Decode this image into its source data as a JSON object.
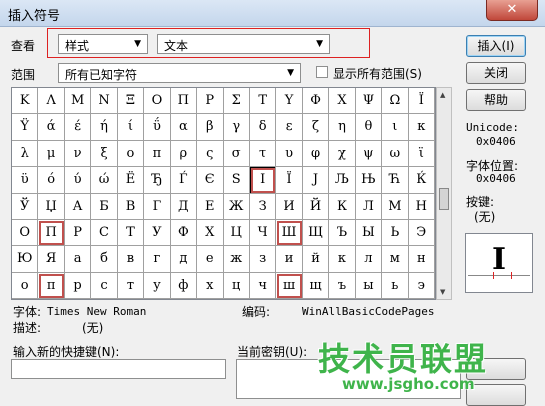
{
  "window": {
    "title": "插入符号",
    "close_glyph": "✕"
  },
  "look_in": {
    "label": "查看",
    "font_value": "样式",
    "type_value": "文本"
  },
  "range": {
    "label": "范围",
    "value": "所有已知字符",
    "show_all_label": "显示所有范围(S)",
    "show_all_checked": false
  },
  "buttons": {
    "insert": "插入(I)",
    "close": "关闭",
    "help": "帮助"
  },
  "grid": {
    "rows": [
      [
        "Κ",
        "Λ",
        "Μ",
        "Ν",
        "Ξ",
        "Ο",
        "Π",
        "Ρ",
        "Σ",
        "Τ",
        "Υ",
        "Φ",
        "Χ",
        "Ψ",
        "Ω",
        "Ϊ"
      ],
      [
        "Ϋ",
        "ά",
        "έ",
        "ή",
        "ί",
        "ΰ",
        "α",
        "β",
        "γ",
        "δ",
        "ε",
        "ζ",
        "η",
        "θ",
        "ι",
        "κ"
      ],
      [
        "λ",
        "μ",
        "ν",
        "ξ",
        "ο",
        "π",
        "ρ",
        "ς",
        "σ",
        "τ",
        "υ",
        "φ",
        "χ",
        "ψ",
        "ω",
        "ϊ"
      ],
      [
        "ϋ",
        "ό",
        "ύ",
        "ώ",
        "Ё",
        "Ђ",
        "Ѓ",
        "Є",
        "Ѕ",
        "І",
        "Ї",
        "Ј",
        "Љ",
        "Њ",
        "Ћ",
        "Ќ"
      ],
      [
        "Ў",
        "Џ",
        "А",
        "Б",
        "В",
        "Г",
        "Д",
        "Е",
        "Ж",
        "З",
        "И",
        "Й",
        "К",
        "Л",
        "М",
        "Н"
      ],
      [
        "О",
        "П",
        "Р",
        "С",
        "Т",
        "У",
        "Ф",
        "Х",
        "Ц",
        "Ч",
        "Ш",
        "Щ",
        "Ъ",
        "Ы",
        "Ь",
        "Э"
      ],
      [
        "Ю",
        "Я",
        "а",
        "б",
        "в",
        "г",
        "д",
        "е",
        "ж",
        "з",
        "и",
        "й",
        "к",
        "л",
        "м",
        "н"
      ],
      [
        "о",
        "п",
        "р",
        "с",
        "т",
        "у",
        "ф",
        "х",
        "ц",
        "ч",
        "ш",
        "щ",
        "ъ",
        "ы",
        "ь",
        "э"
      ]
    ],
    "selected_char": "І",
    "highlighted_chars": [
      "І",
      "П",
      "Ш",
      "п",
      "ш"
    ],
    "highlight_color": "#c0504d"
  },
  "info": {
    "unicode_label": "Unicode:",
    "unicode_value": "0x0406",
    "position_label": "字体位置:",
    "position_value": "0x0406",
    "key_label": "按键:",
    "key_value": "(无)",
    "preview_char": "I"
  },
  "footer": {
    "font_label": "字体:",
    "font_value": "Times New Roman",
    "encoding_label": "编码:",
    "encoding_value": "WinAllBasicCodePages",
    "desc_label": "描述:",
    "desc_value": "(无)",
    "new_shortcut_label": "输入新的快捷键(N):",
    "current_shortcut_label": "当前密钥(U):",
    "new_shortcut_value": ""
  },
  "watermark": {
    "brand": "技术员联盟",
    "url": "www.jsgho.com",
    "color": "#3fb44b"
  }
}
